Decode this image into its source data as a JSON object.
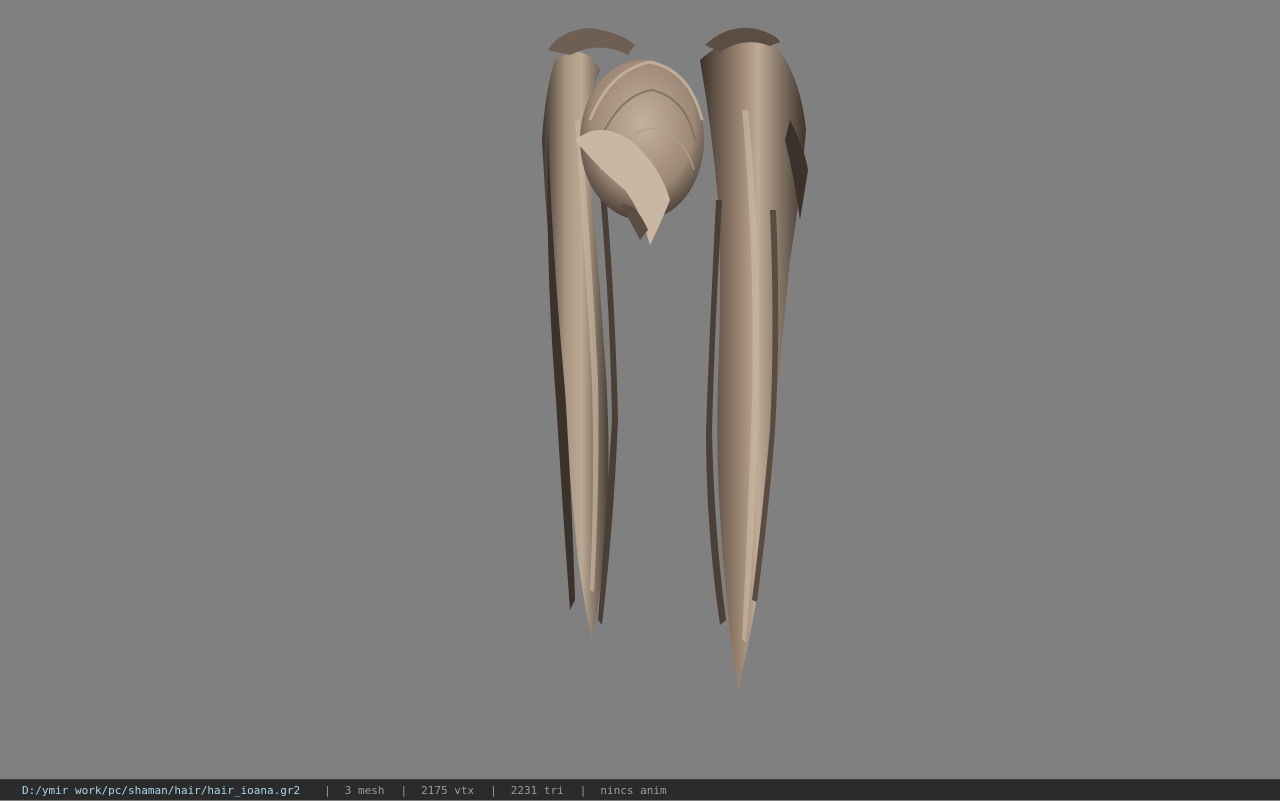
{
  "viewer": {
    "background_color": "#808080",
    "model": {
      "description_icon": "hair-ponytails-model",
      "hair_light": "#b7a592",
      "hair_mid": "#8f7c6a",
      "hair_dark": "#3e352e"
    }
  },
  "statusbar": {
    "path": "D:/ymir work/pc/shaman/hair/hair_ioana.gr2",
    "separator": "|",
    "mesh": "3 mesh",
    "vertices": "2175 vtx",
    "triangles": "2231 tri",
    "anim": "nincs anim",
    "colors": {
      "background": "#2b2b2b",
      "path": "#a9d6ec",
      "text": "#9a9a9a"
    }
  }
}
